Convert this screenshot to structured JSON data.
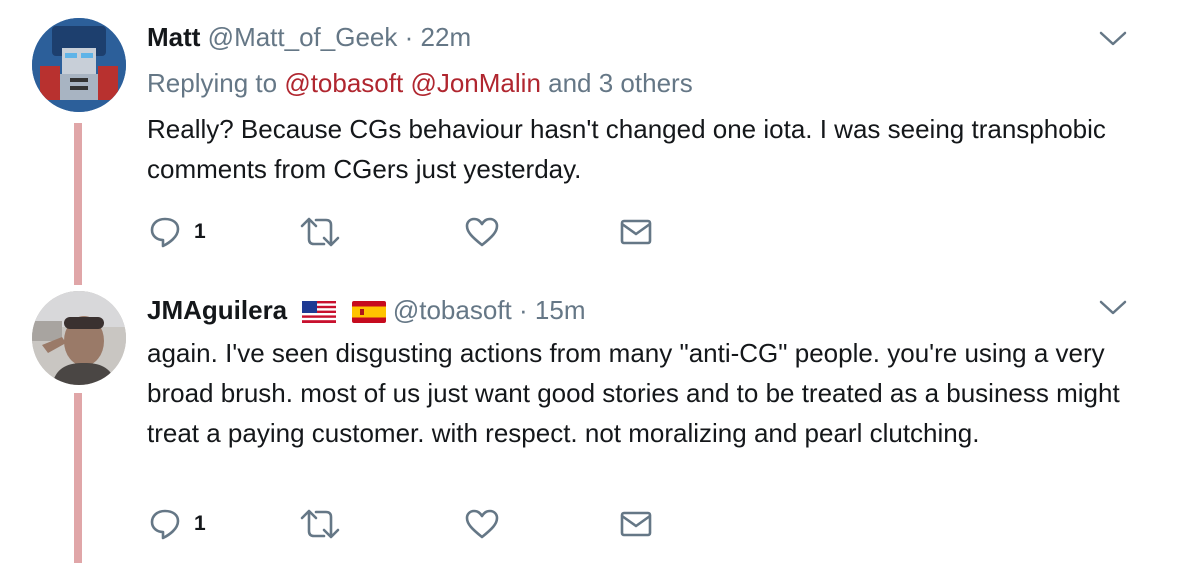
{
  "tweets": [
    {
      "name": "Matt",
      "handle": "@Matt_of_Geek",
      "separator": "·",
      "time": "22m",
      "reply_prefix": "Replying to",
      "mentions": [
        "@tobasoft",
        "@JonMalin"
      ],
      "reply_suffix": "and 3 others",
      "text": "Really? Because CGs behaviour hasn't changed one iota. I was seeing transphobic comments from CGers just yesterday.",
      "reply_count": "1",
      "avatar_icon": "robot-avatar",
      "colors": {
        "thread_line": "#e0a6a8",
        "mention": "#b0262f"
      }
    },
    {
      "name": "JMAguilera",
      "flags": [
        "us-flag-icon",
        "spain-flag-icon"
      ],
      "handle": "@tobasoft",
      "separator": "·",
      "time": "15m",
      "text": "again. I've seen disgusting actions from many \"anti-CG\" people. you're using a very broad brush. most of us just want good stories and to be treated as a business might treat a paying customer. with respect. not moralizing and pearl clutching.",
      "reply_count": "1",
      "avatar_icon": "person-avatar"
    }
  ]
}
